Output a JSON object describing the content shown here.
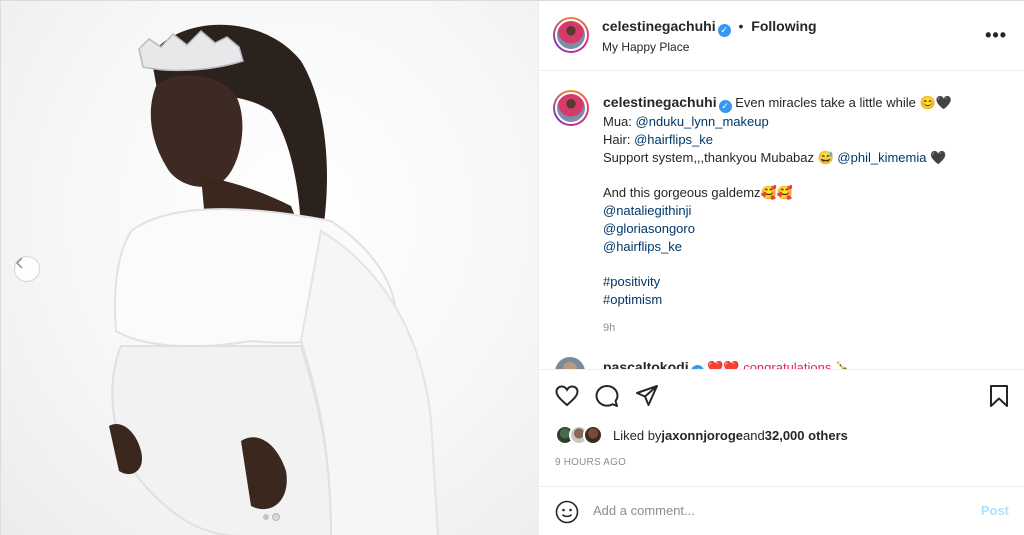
{
  "header": {
    "username": "celestinegachuhi",
    "separator": "•",
    "follow_status": "Following",
    "location": "My Happy Place",
    "more_label": "•••"
  },
  "caption": {
    "username": "celestinegachuhi",
    "lines": [
      "Even miracles take a little while 😊🖤",
      "Mua: ",
      "Hair: ",
      "Support system,,,thankyou Mubabaz 😅 ",
      "And this gorgeous galdemz🥰🥰"
    ],
    "mua_handle": "@nduku_lynn_makeup",
    "hair_handle": "@hairflips_ke",
    "support_handle": "@phil_kimemia",
    "support_suffix": " 🖤",
    "mentions": [
      "@nataliegithinji",
      "@gloriasongoro",
      "@hairflips_ke"
    ],
    "hashtags": [
      "#positivity",
      "#optimism"
    ],
    "time": "9h"
  },
  "second_comment": {
    "username": "pascaltokodi",
    "text": "❤️❤️ congratulations 🍾"
  },
  "likes": {
    "prefix": "Liked by ",
    "user": "jaxonnjoroge",
    "middle": " and ",
    "count": "32,000 others"
  },
  "timestamp": "9 HOURS AGO",
  "comment_box": {
    "placeholder": "Add a comment...",
    "post_label": "Post"
  },
  "carousel": {
    "slides": 2,
    "active_index": 1
  },
  "colors": {
    "link": "#00376b",
    "verified": "#3897f0",
    "post_disabled": "#b2dffc",
    "heart": "#e0245e"
  }
}
